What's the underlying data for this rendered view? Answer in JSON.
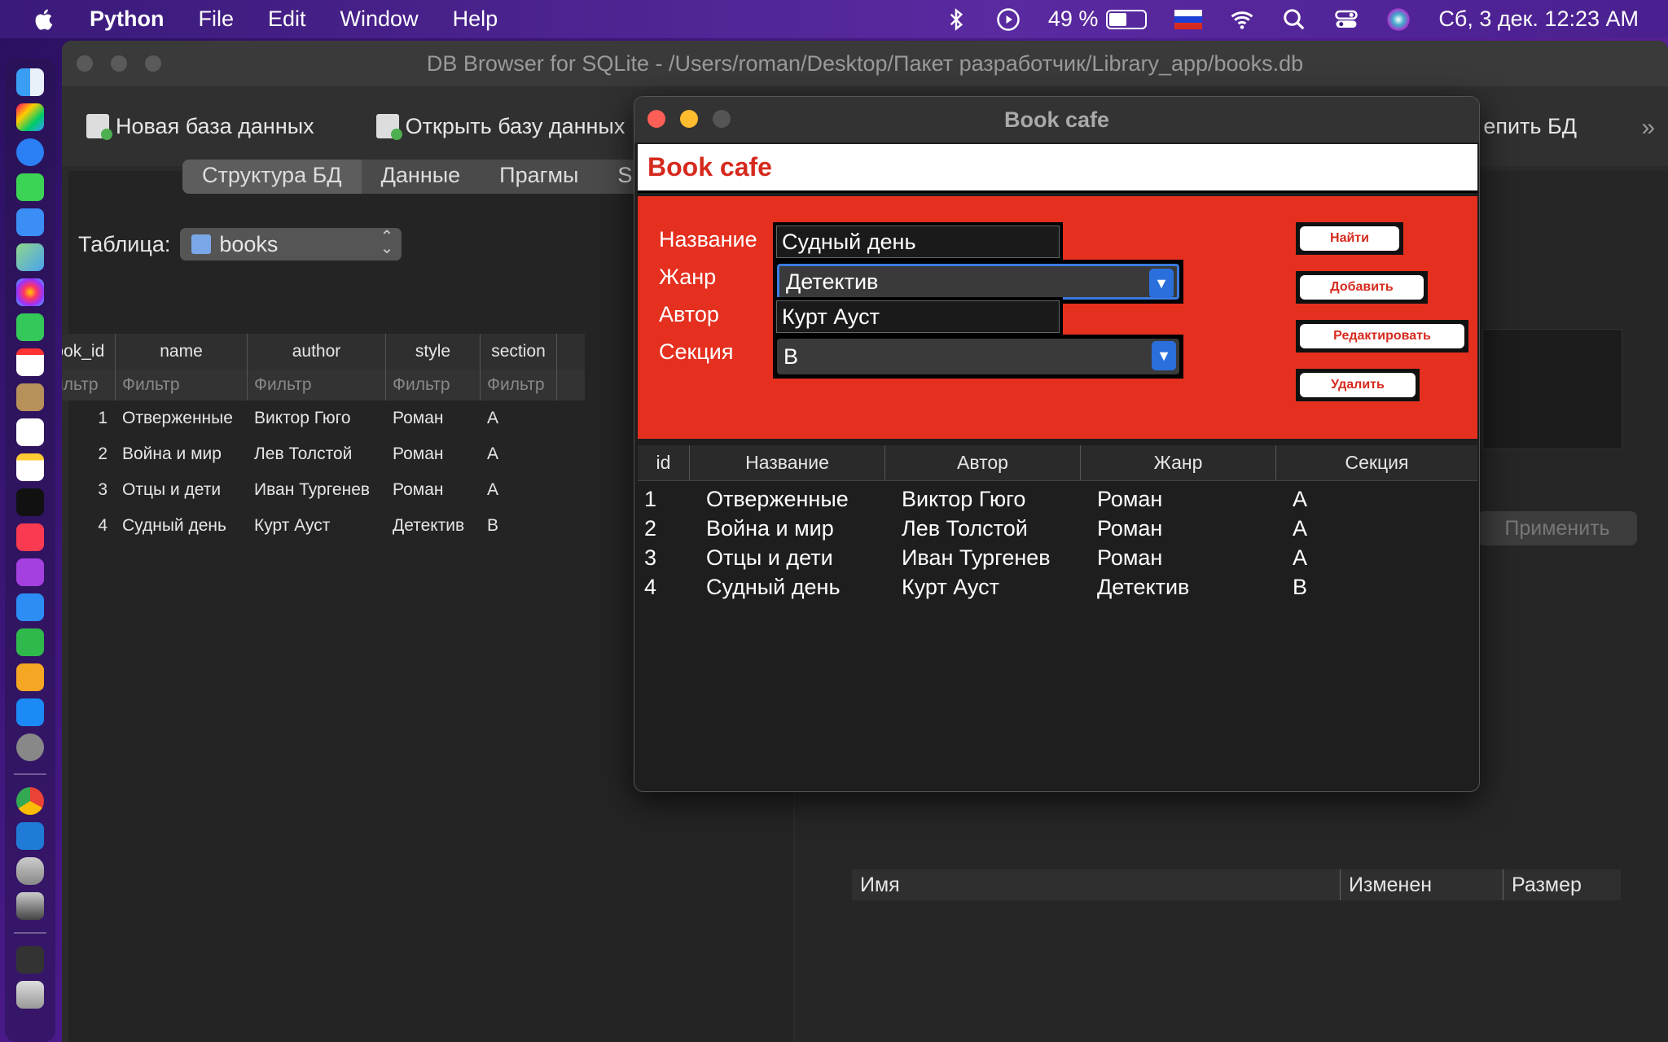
{
  "menubar": {
    "app": "Python",
    "items": [
      "File",
      "Edit",
      "Window",
      "Help"
    ],
    "battery_percent": "49 %",
    "battery_level": 0.49,
    "datetime": "Сб, 3 дек.  12:23 AM"
  },
  "main_window": {
    "title": "DB Browser for SQLite - /Users/roman/Desktop/Пакет разработчик/Library_app/books.db",
    "toolbar": {
      "new_db": "Новая база данных",
      "open_db": "Открыть базу данных",
      "right_label": "епить БД"
    },
    "tabs": [
      "Структура БД",
      "Данные",
      "Прагмы",
      "S"
    ],
    "table_label": "Таблица:",
    "table_name": "books",
    "grid": {
      "columns": [
        "book_id",
        "name",
        "author",
        "style",
        "section"
      ],
      "filter": "Фильтр",
      "rows": [
        {
          "n": "1",
          "book_id": "1",
          "name": "Отверженные",
          "author": "Виктор Гюго",
          "style": "Роман",
          "section": "A"
        },
        {
          "n": "2",
          "book_id": "2",
          "name": "Война и мир",
          "author": "Лев Толстой",
          "style": "Роман",
          "section": "A"
        },
        {
          "n": "3",
          "book_id": "3",
          "name": "Отцы и дети",
          "author": "Иван Тургенев",
          "style": "Роман",
          "section": "A"
        },
        {
          "n": "4",
          "book_id": "4",
          "name": "Судный день",
          "author": "Курт Ауст",
          "style": "Детектив",
          "section": "B"
        }
      ]
    },
    "apply_label": "Применить",
    "files": {
      "name": "Имя",
      "modified": "Изменен",
      "size": "Размер"
    }
  },
  "cafe": {
    "title": "Book cafe",
    "header": "Book cafe",
    "labels": {
      "title": "Название",
      "genre": "Жанр",
      "author": "Автор",
      "section": "Секция"
    },
    "values": {
      "title": "Судный день",
      "genre": "Детектив",
      "author": "Курт Ауст",
      "section": "B"
    },
    "buttons": {
      "find": "Найти",
      "add": "Добавить",
      "edit": "Редактировать",
      "delete": "Удалить"
    },
    "columns": [
      "id",
      "Название",
      "Автор",
      "Жанр",
      "Секция"
    ],
    "rows": [
      {
        "id": "1",
        "title": "Отверженные",
        "author": "Виктор Гюго",
        "genre": "Роман",
        "section": "A"
      },
      {
        "id": "2",
        "title": "Война и мир",
        "author": "Лев Толстой",
        "genre": "Роман",
        "section": "A"
      },
      {
        "id": "3",
        "title": "Отцы и дети",
        "author": "Иван Тургенев",
        "genre": "Роман",
        "section": "A"
      },
      {
        "id": "4",
        "title": "Судный день",
        "author": "Курт Ауст",
        "genre": "Детектив",
        "section": "B"
      }
    ]
  },
  "colors": {
    "cafe_red": "#e52f1f",
    "accent_blue": "#2a6fdb"
  },
  "icons": [
    "apple-icon",
    "bluetooth-icon",
    "play-icon",
    "battery-icon",
    "wifi-icon",
    "search-icon",
    "control-center-icon",
    "siri-icon"
  ]
}
